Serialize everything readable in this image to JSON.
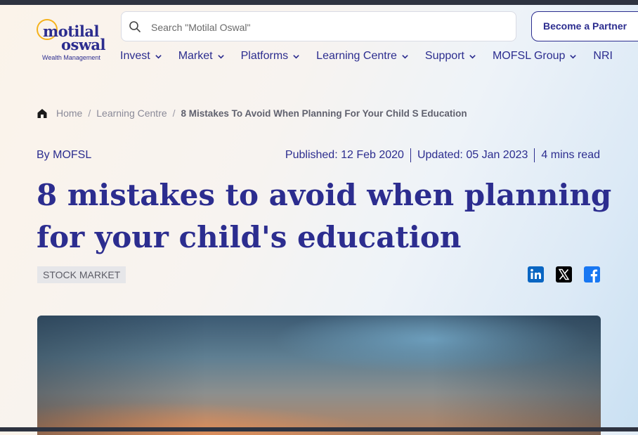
{
  "logo": {
    "line1": "motilal",
    "line2": "oswal",
    "sub": "Wealth Management"
  },
  "search": {
    "placeholder": "Search \"Motilal Oswal\""
  },
  "header": {
    "partner_label": "Become a Partner"
  },
  "nav": {
    "items": [
      {
        "label": "Invest"
      },
      {
        "label": "Market"
      },
      {
        "label": "Platforms"
      },
      {
        "label": "Learning Centre"
      },
      {
        "label": "Support"
      },
      {
        "label": "MOFSL Group"
      },
      {
        "label": "NRI"
      }
    ]
  },
  "breadcrumb": {
    "home": "Home",
    "section": "Learning Centre",
    "current": "8 Mistakes To Avoid When Planning For Your Child S Education"
  },
  "article": {
    "author": "By MOFSL",
    "published": "Published: 12 Feb 2020",
    "updated": "Updated: 05 Jan 2023",
    "read_time": "4 mins read",
    "title": "8 mistakes to avoid when planning for your child's education",
    "tag": "STOCK MARKET"
  },
  "share": {
    "icons": [
      "linkedin-icon",
      "x-icon",
      "facebook-icon"
    ]
  },
  "colors": {
    "brand": "#2c2d8f",
    "logo_accent": "#f5b21c",
    "linkedin": "#0a66c2",
    "facebook": "#1877f2"
  }
}
